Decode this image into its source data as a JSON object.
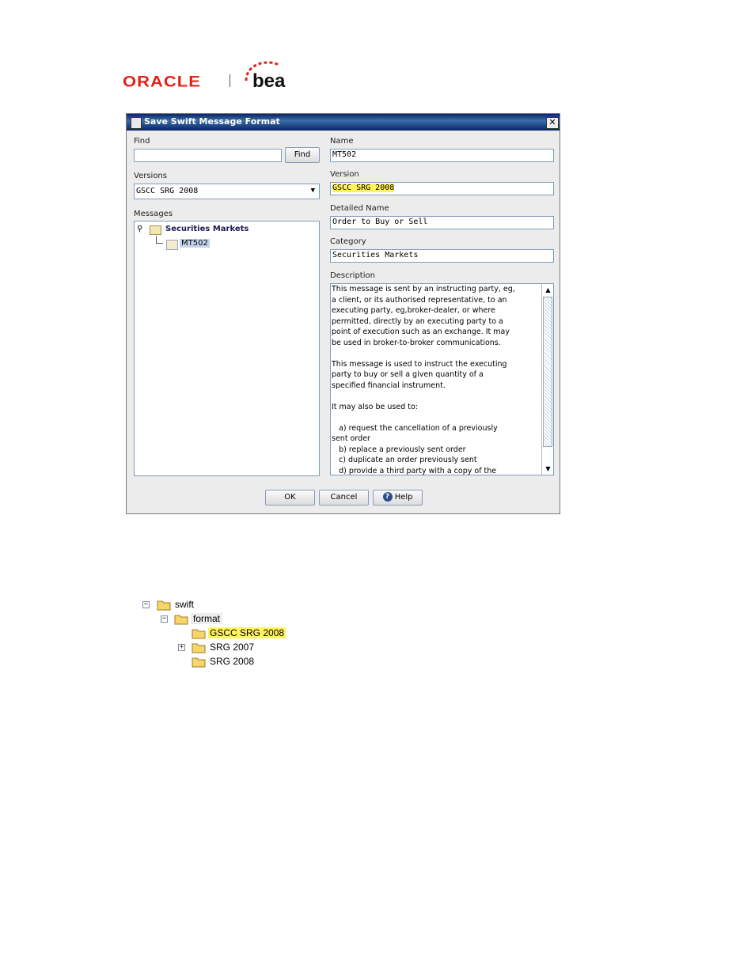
{
  "logos": {
    "oracle": "ORACLE",
    "bea": "bea"
  },
  "dialog": {
    "title": "Save Swift Message Format",
    "close_label": "✕",
    "left": {
      "find_label": "Find",
      "find_value": "",
      "find_button": "Find",
      "versions_label": "Versions",
      "versions_selected": "GSCC SRG 2008",
      "messages_label": "Messages",
      "tree": {
        "root": "Securities Markets",
        "child": "MT502"
      }
    },
    "right": {
      "name_label": "Name",
      "name_value": "MT502",
      "version_label": "Version",
      "version_value": "GSCC SRG 2008",
      "detailed_name_label": "Detailed Name",
      "detailed_name_value": "Order to Buy or Sell",
      "category_label": "Category",
      "category_value": "Securities Markets",
      "description_label": "Description",
      "description_value": "This message is sent by an instructing party, eg,\na client, or its authorised representative, to an\nexecuting party, eg,broker-dealer, or where\npermitted, directly by an executing party to a\npoint of execution such as an exchange. It may\nbe used in broker-to-broker communications.\n\nThis message is used to instruct the executing\nparty to buy or sell a given quantity of a\nspecified financial instrument.\n\nIt may also be used to:\n\n   a) request the cancellation of a previously\nsent order\n   b) replace a previously sent order\n   c) duplicate an order previously sent\n   d) provide a third party with a copy of the"
    },
    "buttons": {
      "ok": "OK",
      "cancel": "Cancel",
      "help": "Help"
    }
  },
  "folder_tree": {
    "root": "swift",
    "child": "format",
    "items": [
      "GSCC SRG 2008",
      "SRG 2007",
      "SRG 2008"
    ]
  },
  "colors": {
    "highlight": "#fff45a",
    "title_bar": "#0a246a",
    "oracle_red": "#e2231a"
  }
}
